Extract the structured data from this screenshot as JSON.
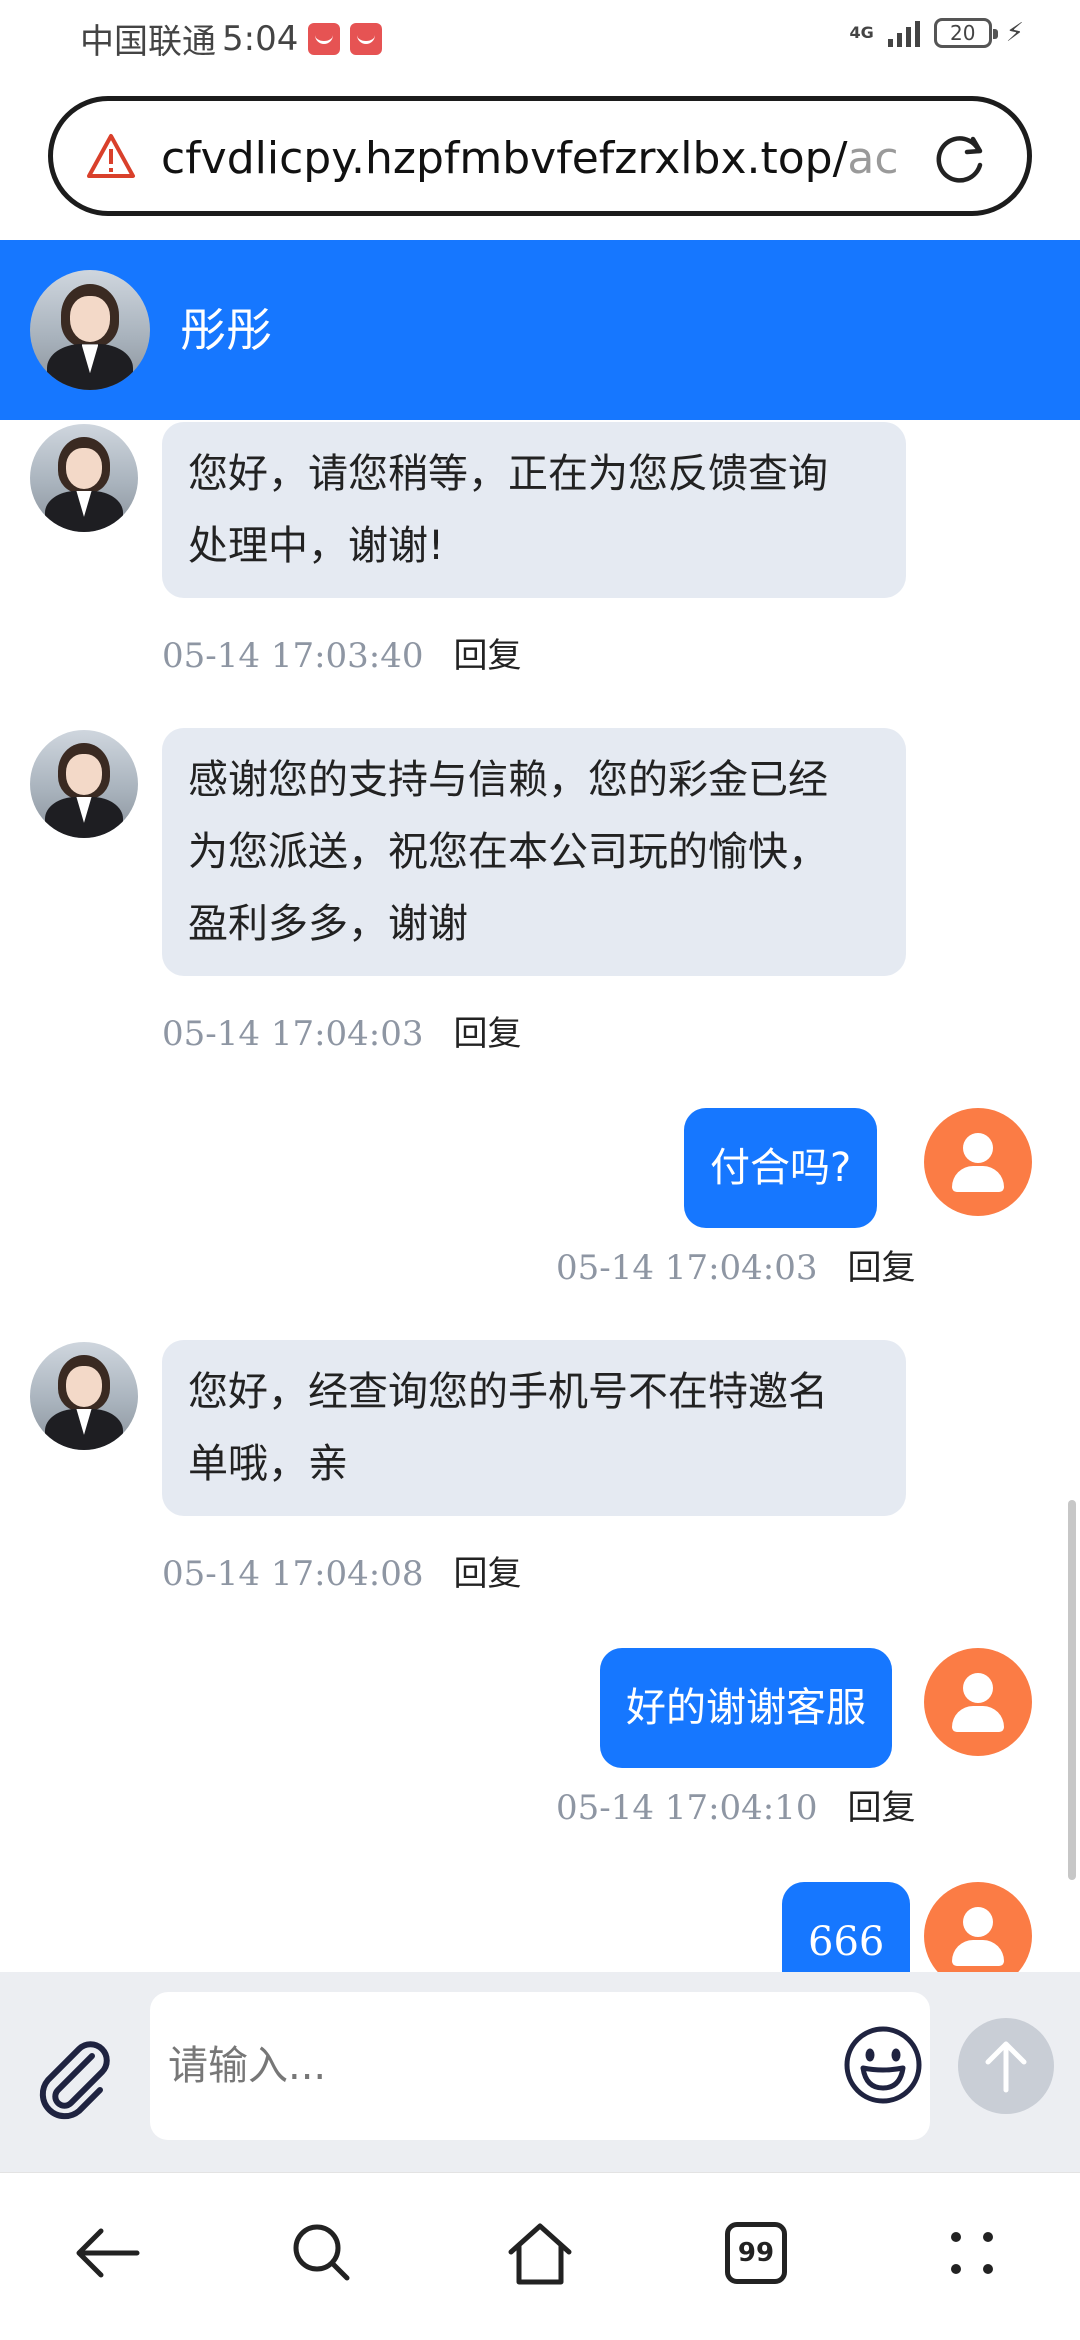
{
  "status_bar": {
    "carrier": "中国联通",
    "time": "5:04",
    "network": "4G",
    "battery": "20"
  },
  "browser": {
    "url_main": "cfvdlicpy.hzpfmbvfefzrxlbx.top/",
    "url_faded": "ac"
  },
  "chat": {
    "agent_name": "彤彤",
    "reply_label": "回复",
    "messages": [
      {
        "side": "in",
        "text_line1": "您好，请您稍等，正在为您反馈查询",
        "text_line2": "处理中，谢谢!",
        "time": "05-14 17:03:40"
      },
      {
        "side": "in",
        "text_line1": "感谢您的支持与信赖，您的彩金已经",
        "text_line2": "为您派送，祝您在本公司玩的愉快，",
        "text_line3": "盈利多多，谢谢",
        "time": "05-14 17:04:03"
      },
      {
        "side": "out",
        "text": "付合吗?",
        "time": "05-14 17:04:03"
      },
      {
        "side": "in",
        "text_line1": "您好，经查询您的手机号不在特邀名",
        "text_line2": "单哦，亲",
        "time": "05-14 17:04:08"
      },
      {
        "side": "out",
        "text": "好的谢谢客服",
        "time": "05-14 17:04:10"
      },
      {
        "side": "out",
        "text": "666",
        "time": ""
      }
    ]
  },
  "composer": {
    "placeholder": "请输入..."
  },
  "nav": {
    "tabs_count": "99"
  },
  "icons": [
    "warning-icon",
    "reload-icon",
    "paperclip-icon",
    "emoji-icon",
    "arrow-up-icon",
    "back-icon",
    "search-icon",
    "home-icon",
    "tabs-icon",
    "more-icon"
  ],
  "colors": {
    "header_blue": "#1677ff",
    "incoming_bubble": "#e5eaf2",
    "user_avatar": "#fb7c45"
  }
}
